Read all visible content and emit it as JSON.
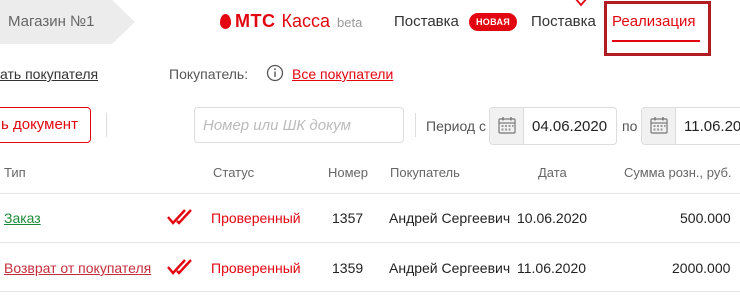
{
  "header": {
    "store_tab": "Магазин №1",
    "logo_brand": "МТС",
    "logo_product": "Касса",
    "logo_beta": "beta",
    "nav": {
      "supply_label": "Поставка",
      "supply_badge": "НОВАЯ",
      "supply2_label": "Поставка",
      "active_label": "Реализация"
    }
  },
  "toolbar": {
    "customer_link": "ать покупателя",
    "buyer_label": "Покупатель:",
    "buyer_value": "Все покупатели",
    "doc_button": "ь документ",
    "search_placeholder": "Номер или ШК докум",
    "period_label": "Период с",
    "date_from": "04.06.2020",
    "po_label": "по",
    "date_to": "11.06.20"
  },
  "table": {
    "columns": {
      "type": "Тип",
      "status": "Статус",
      "number": "Номер",
      "customer": "Покупатель",
      "date": "Дата",
      "sum": "Сумма розн., руб."
    },
    "rows": [
      {
        "type": "Заказ",
        "status": "Проверенный",
        "number": "1357",
        "customer": "Андрей Сергеевич",
        "date": "10.06.2020",
        "sum": "500.000"
      },
      {
        "type": "Возврат от покупателя",
        "status": "Проверенный",
        "number": "1359",
        "customer": "Андрей Сергеевич",
        "date": "11.06.2020",
        "sum": "2000.000"
      }
    ]
  },
  "colors": {
    "brand_red": "#e30611",
    "order_green": "#1f8a3a",
    "return_red": "#c42d3b",
    "highlight_box": "#b01c22"
  },
  "icons": {
    "info": "info-icon",
    "calendar": "calendar-icon",
    "status": "double-check-icon",
    "chevron": "chevron-down-icon"
  }
}
